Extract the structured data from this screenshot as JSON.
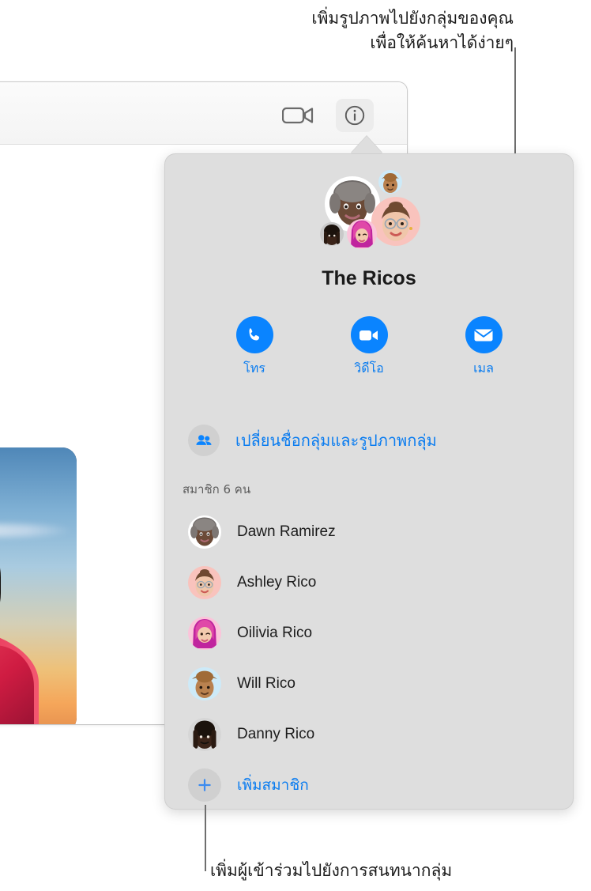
{
  "callouts": {
    "top": "เพิ่มรูปภาพไปยังกลุ่มของคุณ\nเพื่อให้ค้นหาได้ง่ายๆ",
    "bottom": "เพิ่มผู้เข้าร่วมไปยังการสนทนากลุ่ม"
  },
  "toolbar": {
    "video_icon": "video-camera-icon",
    "info_icon": "info-circle-icon"
  },
  "message": {
    "photo_alt": "photo-of-woman-at-sunset"
  },
  "popover": {
    "group_title": "The Ricos",
    "actions": [
      {
        "label": "โทร",
        "icon": "phone-icon"
      },
      {
        "label": "วิดีโอ",
        "icon": "video-icon"
      },
      {
        "label": "เมล",
        "icon": "mail-icon"
      }
    ],
    "rename_label": "เปลี่ยนชื่อกลุ่มและรูปภาพกลุ่ม",
    "rename_icon": "two-people-icon",
    "members_count_label": "สมาชิก 6 คน",
    "members": [
      {
        "name": "Dawn Ramirez",
        "avatar_bg": "#ffffff"
      },
      {
        "name": "Ashley Rico",
        "avatar_bg": "#f9c3bd"
      },
      {
        "name": "Oilivia Rico",
        "avatar_bg": "#fbc4da"
      },
      {
        "name": "Will Rico",
        "avatar_bg": "#cdeaf8"
      },
      {
        "name": "Danny Rico",
        "avatar_bg": "#d6d6d6"
      }
    ],
    "add_member_label": "เพิ่มสมาชิก",
    "add_member_icon": "plus-icon"
  },
  "colors": {
    "accent_blue": "#0a84ff",
    "link_blue": "#0a7cf0",
    "popover_bg": "#dedede",
    "leader_line": "#6e6e6e"
  }
}
